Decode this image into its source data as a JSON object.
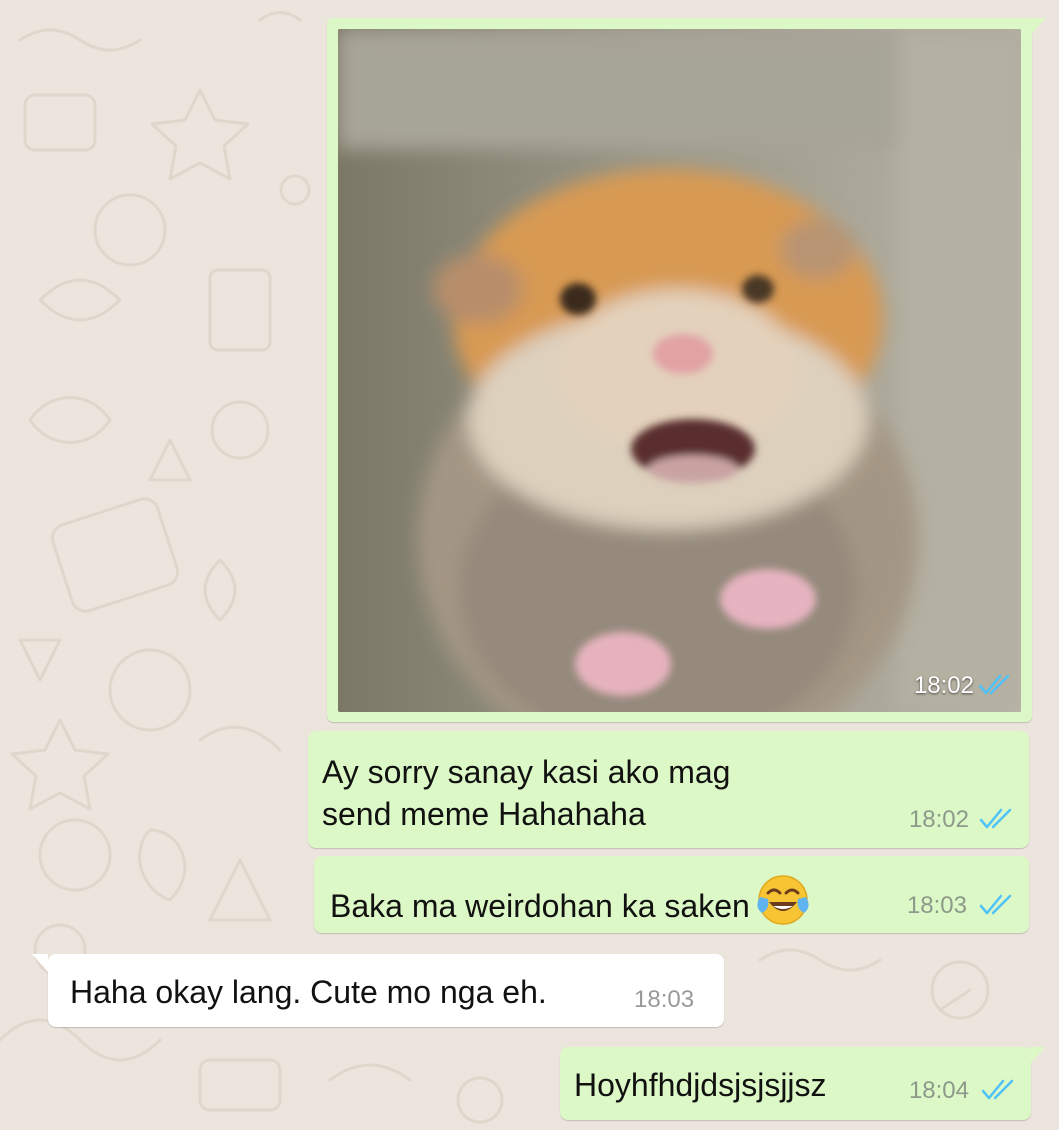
{
  "messages": [
    {
      "type": "image",
      "direction": "outgoing",
      "image_subject": "blurry frightened hamster meme",
      "time": "18:02",
      "status": "read"
    },
    {
      "type": "text",
      "direction": "outgoing",
      "line1": "Ay sorry sanay kasi ako mag",
      "line2": "send meme Hahahaha",
      "time": "18:02",
      "status": "read"
    },
    {
      "type": "text",
      "direction": "outgoing",
      "text": "Baka ma weirdohan ka saken",
      "emoji": "face-with-tears-of-joy",
      "time": "18:03",
      "status": "read"
    },
    {
      "type": "text",
      "direction": "incoming",
      "text": "Haha okay lang. Cute mo nga eh.",
      "time": "18:03"
    },
    {
      "type": "text",
      "direction": "outgoing",
      "text": "Hoyhfhdjdsjsjsjjsz",
      "time": "18:04",
      "status": "read"
    }
  ],
  "colors": {
    "outgoing_bubble": "#dcf8c6",
    "incoming_bubble": "#ffffff",
    "wallpaper": "#ece5dd",
    "read_ticks": "#4fc3f7",
    "timestamp": "#8d998a"
  }
}
